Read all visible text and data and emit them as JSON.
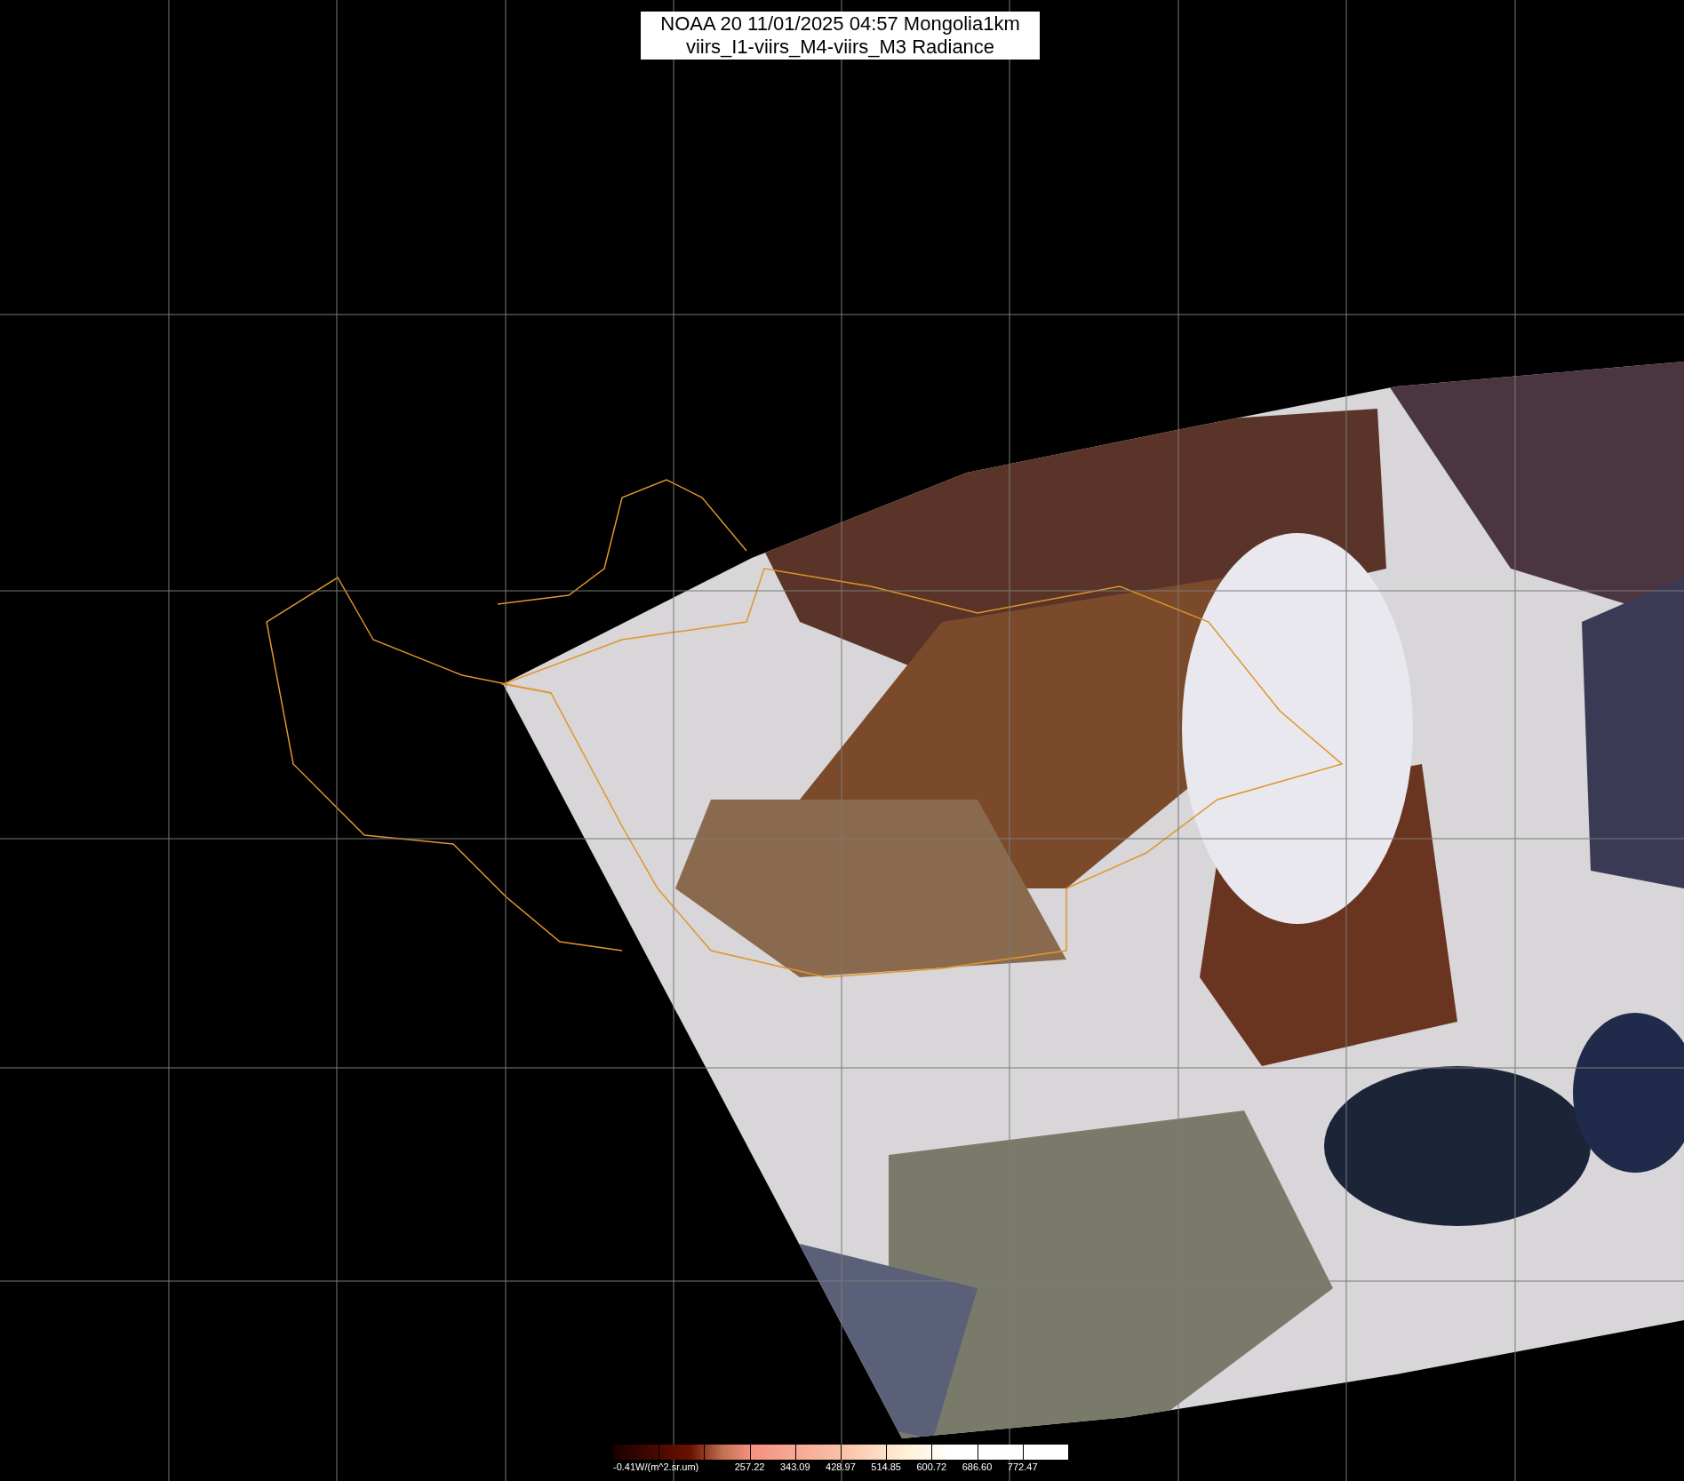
{
  "title": {
    "lines": [
      "NOAA 20 11/01/2025 04:57 Mongolia1km",
      "viirs_I1-viirs_M4-viirs_M3 Radiance"
    ]
  },
  "colorbar": {
    "labels": [
      "-0.41W/(m^2.sr.um)",
      "257.22",
      "343.09",
      "428.97",
      "514.85",
      "600.72",
      "686.60",
      "772.47"
    ]
  }
}
